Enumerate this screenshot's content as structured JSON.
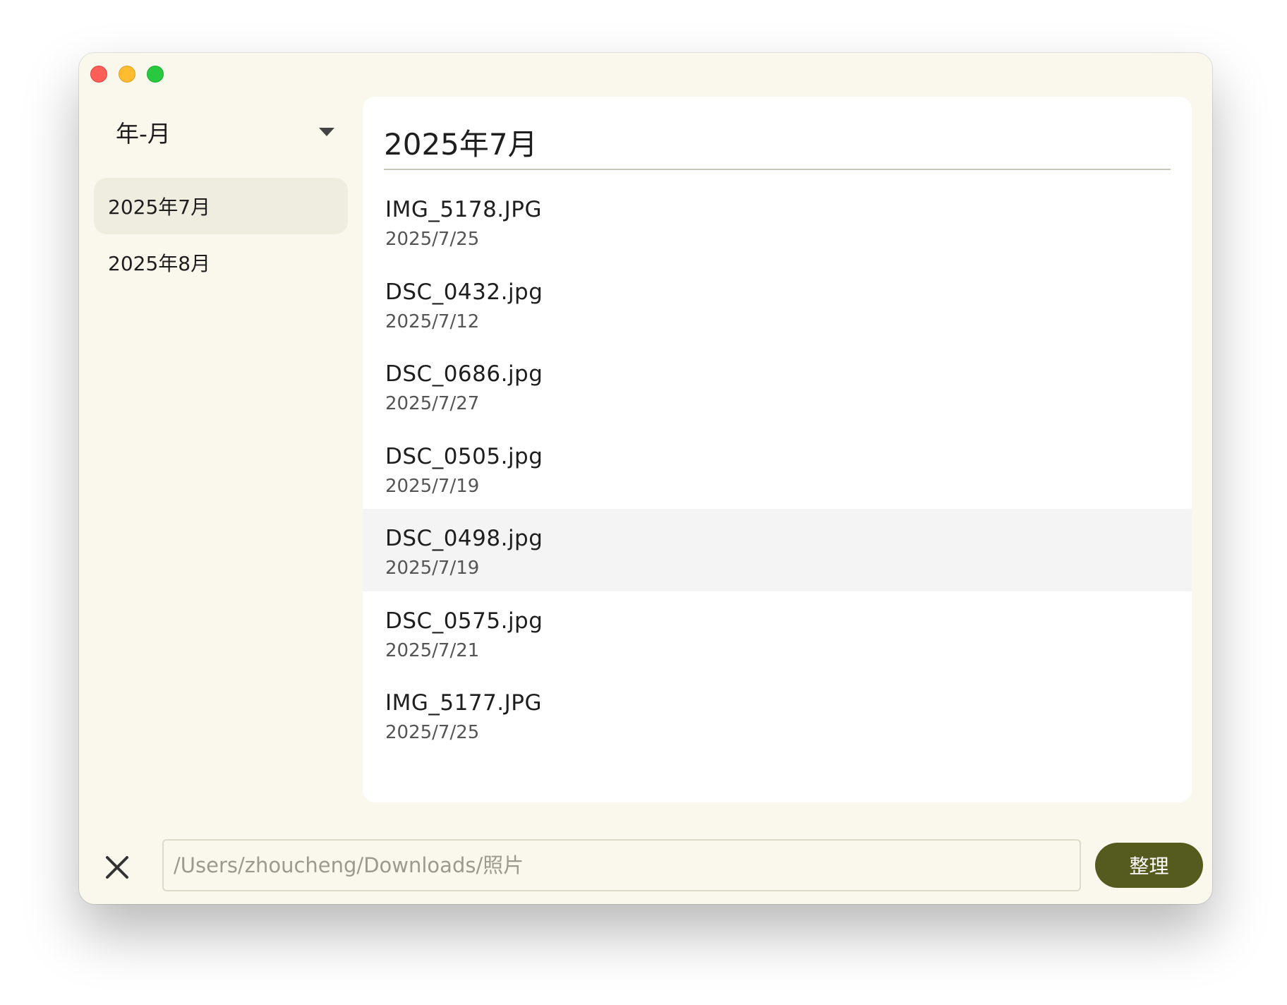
{
  "window": {
    "controls": [
      "close",
      "minimize",
      "maximize"
    ]
  },
  "sidebar": {
    "group_by": {
      "label": "年-月",
      "icon": "chevron-down-icon"
    },
    "items": [
      {
        "label": "2025年7月",
        "selected": true
      },
      {
        "label": "2025年8月",
        "selected": false
      }
    ]
  },
  "main": {
    "title": "2025年7月",
    "files": [
      {
        "name": "IMG_5178.JPG",
        "date": "2025/7/25"
      },
      {
        "name": "DSC_0432.jpg",
        "date": "2025/7/12"
      },
      {
        "name": "DSC_0686.jpg",
        "date": "2025/7/27"
      },
      {
        "name": "DSC_0505.jpg",
        "date": "2025/7/19"
      },
      {
        "name": "DSC_0498.jpg",
        "date": "2025/7/19",
        "hovered": true
      },
      {
        "name": "DSC_0575.jpg",
        "date": "2025/7/21"
      },
      {
        "name": "IMG_5177.JPG",
        "date": "2025/7/25"
      }
    ]
  },
  "footer": {
    "close_icon": "close-icon",
    "path_placeholder": "/Users/zhoucheng/Downloads/照片",
    "path_value": "",
    "organize_label": "整理"
  },
  "colors": {
    "window_bg": "#faf8ec",
    "panel_bg": "#ffffff",
    "selected_item_bg": "#efede0",
    "hover_row_bg": "#f4f4f4",
    "accent": "#555b1e"
  }
}
